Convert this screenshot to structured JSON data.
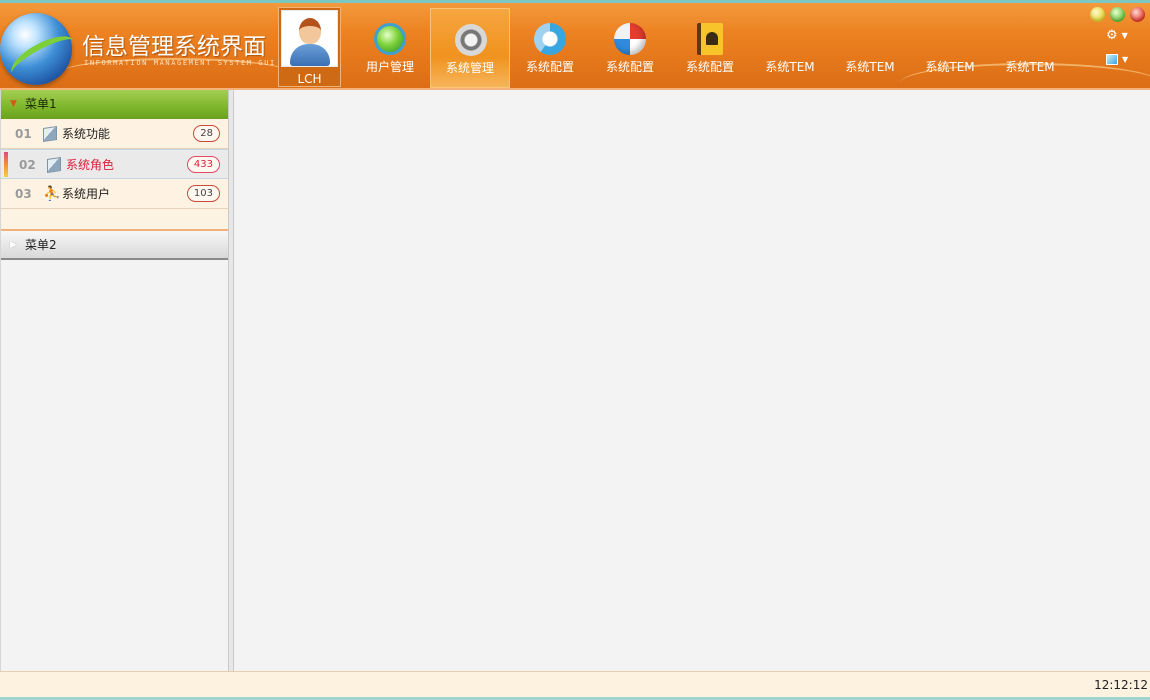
{
  "app": {
    "title": "信息管理系统界面",
    "subtitle": "INFORMATION MANAGEMENT SYSTEM GUI"
  },
  "user": {
    "name": "LCH"
  },
  "nav": [
    {
      "label": "用户管理",
      "icon": "user-management-icon",
      "active": false
    },
    {
      "label": "系统管理",
      "icon": "gear-icon",
      "active": true
    },
    {
      "label": "系统配置",
      "icon": "donut-chart-icon",
      "active": false
    },
    {
      "label": "系统配置",
      "icon": "ball-icon",
      "active": false
    },
    {
      "label": "系统配置",
      "icon": "contact-book-icon",
      "active": false
    },
    {
      "label": "系统TEM",
      "icon": "",
      "active": false
    },
    {
      "label": "系统TEM",
      "icon": "",
      "active": false
    },
    {
      "label": "系统TEM",
      "icon": "",
      "active": false
    },
    {
      "label": "系统TEM",
      "icon": "",
      "active": false
    }
  ],
  "sidebar": {
    "menu1": {
      "label": "菜单1",
      "expanded": true,
      "items": [
        {
          "num": "01",
          "label": "系统功能",
          "count": "28",
          "icon": "cube-icon",
          "selected": false
        },
        {
          "num": "02",
          "label": "系统角色",
          "count": "433",
          "icon": "cube-icon",
          "selected": true
        },
        {
          "num": "03",
          "label": "系统用户",
          "count": "103",
          "icon": "person-icon",
          "selected": false
        }
      ]
    },
    "menu2": {
      "label": "菜单2",
      "expanded": false
    }
  },
  "status": {
    "time": "12:12:12"
  },
  "colors": {
    "header": "#e67a1c",
    "menu_open": "#7eb52b",
    "selected_text": "#e01c3a",
    "status_bg": "#fdf1e0"
  }
}
